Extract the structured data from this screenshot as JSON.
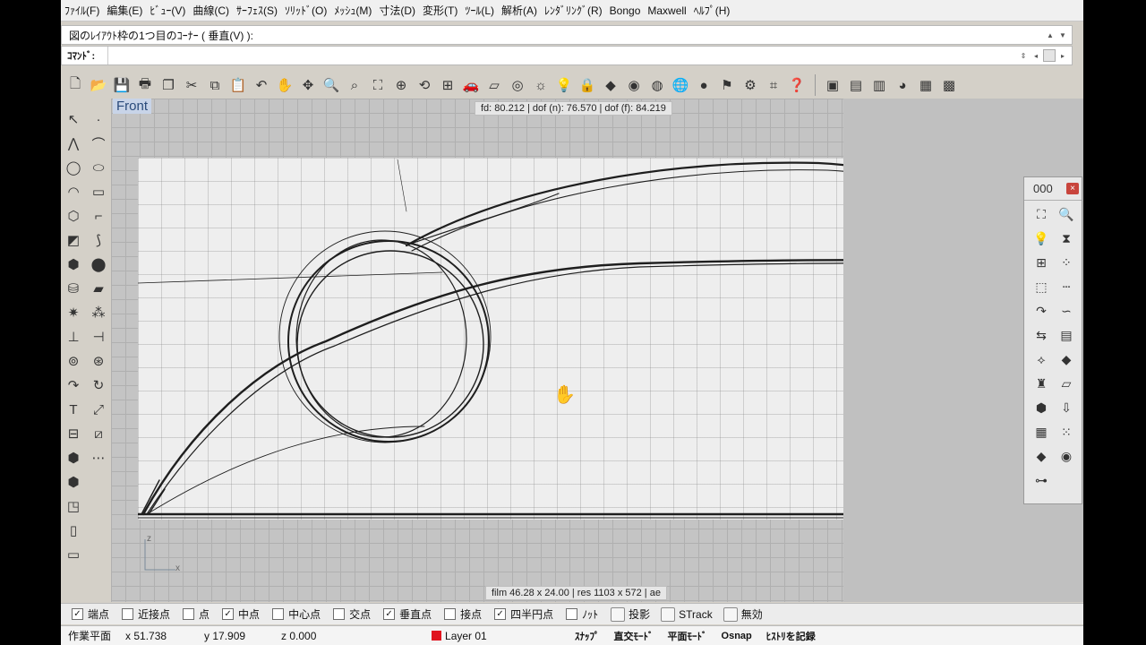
{
  "menu": [
    "ﾌｧｲﾙ(F)",
    "編集(E)",
    "ﾋﾞｭｰ(V)",
    "曲線(C)",
    "ｻｰﾌｪｽ(S)",
    "ｿﾘｯﾄﾞ(O)",
    "ﾒｯｼｭ(M)",
    "寸法(D)",
    "変形(T)",
    "ﾂｰﾙ(L)",
    "解析(A)",
    "ﾚﾝﾀﾞﾘﾝｸﾞ(R)",
    "Bongo",
    "Maxwell",
    "ﾍﾙﾌﾟ(H)"
  ],
  "command": {
    "history": "図のﾚｲｱｳﾄ枠の1つ目のｺｰﾅｰ ( 垂直(V) ):",
    "prompt": "ｺﾏﾝﾄﾞ:",
    "value": ""
  },
  "toolbar_icons": [
    "new-icon",
    "open-icon",
    "save-icon",
    "print-icon",
    "import-icon",
    "cut-icon",
    "copy-icon",
    "paste-icon",
    "undo-icon",
    "pan-icon",
    "rotate-view-icon",
    "zoom-icon",
    "zoom-window-icon",
    "zoom-extents-icon",
    "zoom-selected-icon",
    "rotate-icon",
    "four-view-icon",
    "car-icon",
    "plane-icon",
    "target-icon",
    "light-icon",
    "bulb-icon",
    "lock-icon",
    "layer-icon",
    "color-wheel-icon",
    "sphere-wire-icon",
    "globe-icon",
    "render-sphere-icon",
    "flag-icon",
    "settings-icon",
    "script-icon",
    "help-icon"
  ],
  "toolbar_right_icons": [
    "render-icon",
    "materials-icon",
    "film-icon",
    "camera-icon",
    "render-window-icon",
    "table-icon"
  ],
  "sidebar_icons": [
    "select-icon",
    "point-icon",
    "polyline-icon",
    "curve-icon",
    "circle-icon",
    "ellipse-icon",
    "arc-icon",
    "rectangle-icon",
    "polygon-icon",
    "fillet-icon",
    "surface-icon",
    "loft-icon",
    "box-icon",
    "sphere-icon",
    "cylinder-icon",
    "plane-surface-icon",
    "explode-icon",
    "array-icon",
    "trim-icon",
    "split-icon",
    "group-icon",
    "transform-icon",
    "blend-icon",
    "offset-icon",
    "text-icon",
    "scale-icon",
    "dimension-icon",
    "mirror-icon",
    "solid-icon",
    "mesh-icon",
    "view-icon",
    "layout-icon",
    "cplane-icon",
    "display-icon"
  ],
  "viewport": {
    "label": "Front",
    "readout_top": "fd: 80.212  |  dof (n): 76.570  |  dof (f): 84.219",
    "readout_bottom": "film 46.28 x 24.00  |  res 1103 x 572  |  ae",
    "axis_z": "z",
    "axis_x": "x"
  },
  "panel": {
    "title": "000",
    "close": "×",
    "icons": [
      "zoom-extents-icon",
      "zoom-icon",
      "light-icon",
      "mirror-icon",
      "array-icon",
      "points-icon",
      "rectangle-icon",
      "dash-line-icon",
      "curve-icon",
      "blend-icon",
      "flip-icon",
      "box-icon",
      "select-icon",
      "view-icon",
      "person-icon",
      "plane-icon",
      "cube-icon",
      "grid-arrow-icon",
      "grid-icon",
      "points-grid-icon",
      "layer-icon",
      "color-wheel-icon",
      "network-icon"
    ]
  },
  "osnap": [
    {
      "label": "端点",
      "checked": true
    },
    {
      "label": "近接点",
      "checked": false
    },
    {
      "label": "点",
      "checked": false
    },
    {
      "label": "中点",
      "checked": true
    },
    {
      "label": "中心点",
      "checked": false
    },
    {
      "label": "交点",
      "checked": false
    },
    {
      "label": "垂直点",
      "checked": true
    },
    {
      "label": "接点",
      "checked": false
    },
    {
      "label": "四半円点",
      "checked": true
    },
    {
      "label": "ﾉｯﾄ",
      "checked": false
    }
  ],
  "osnap_toggles": [
    "投影",
    "STrack",
    "無効"
  ],
  "status": {
    "cplane": "作業平面",
    "x": "x 51.738",
    "y": "y 17.909",
    "z": "z 0.000",
    "layer": "Layer 01",
    "layer_color": "#e0141e",
    "snap": "ｽﾅｯﾌﾟ",
    "ortho": "直交ﾓｰﾄﾞ",
    "planar": "平面ﾓｰﾄﾞ",
    "osnap": "Osnap",
    "history": "ﾋｽﾄﾘを記録"
  }
}
